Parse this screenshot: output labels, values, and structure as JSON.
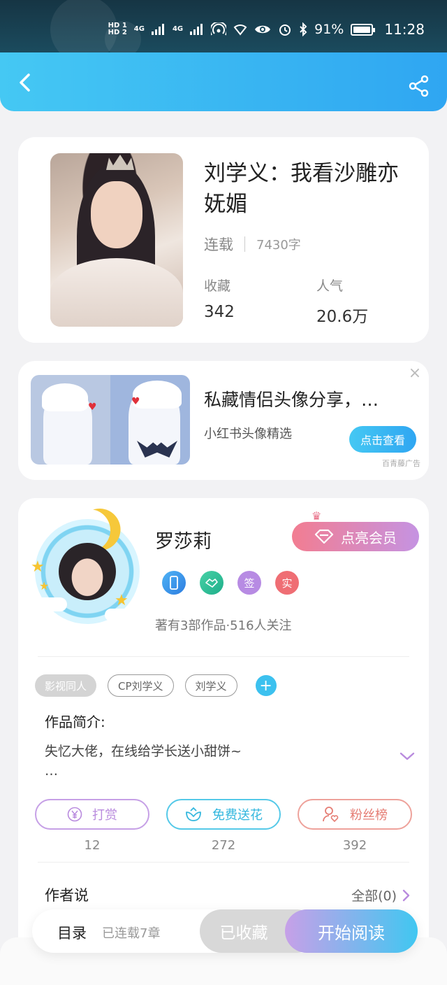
{
  "status_bar": {
    "hd1": "HD 1",
    "hd2": "HD 2",
    "net1": "4G",
    "net2": "4G",
    "battery": "91%",
    "time": "11:28"
  },
  "header": {
    "back_icon": "chevron-left-icon",
    "share_icon": "share-icon"
  },
  "book": {
    "title": "刘学义：我看沙雕亦妩媚",
    "status": "连载",
    "word_count": "7430字",
    "favorites_label": "收藏",
    "favorites_value": "342",
    "popularity_label": "人气",
    "popularity_value": "20.6万"
  },
  "ad": {
    "title": "私藏情侣头像分享，…",
    "subtitle": "小红书头像精选",
    "button": "点击查看",
    "source": "百青藤广告",
    "close": "×"
  },
  "author": {
    "name": "罗莎莉",
    "vip_button": "点亮会员",
    "badges": [
      "",
      "",
      "签",
      "实"
    ],
    "stats": "著有3部作品·516人关注",
    "tags": [
      "影视同人",
      "CP刘学义",
      "刘学义"
    ],
    "add_tag": "+",
    "intro_title": "作品简介:",
    "intro_text": "失忆大佬，在线给学长送小甜饼~",
    "intro_ellipsis": "…",
    "actions": [
      {
        "label": "打赏",
        "count": "12",
        "icon": "yen-coin-icon"
      },
      {
        "label": "免费送花",
        "count": "272",
        "icon": "flower-icon"
      },
      {
        "label": "粉丝榜",
        "count": "392",
        "icon": "user-heart-icon"
      }
    ],
    "author_says": "作者说",
    "all_link": "全部(0)"
  },
  "bottom_bar": {
    "toc": "目录",
    "chapters": "已连载7章",
    "collected": "已收藏",
    "read": "开始阅读"
  },
  "colors": {
    "accent_blue": "#2fa6f2",
    "accent_cyan": "#45c8f3",
    "accent_purple": "#c7a0e8",
    "vip_pink": "#f27d91"
  }
}
